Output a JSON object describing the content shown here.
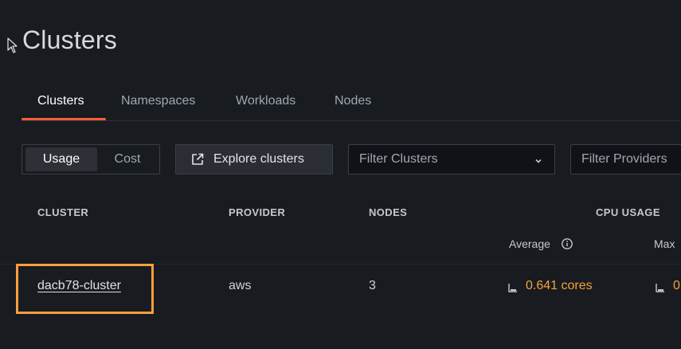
{
  "page": {
    "title": "Clusters"
  },
  "tabs": [
    {
      "label": "Clusters",
      "active": true
    },
    {
      "label": "Namespaces",
      "active": false
    },
    {
      "label": "Workloads",
      "active": false
    },
    {
      "label": "Nodes",
      "active": false
    }
  ],
  "toolbar": {
    "view_toggle": {
      "options": [
        "Usage",
        "Cost"
      ],
      "selected": "Usage"
    },
    "explore_label": "Explore clusters",
    "filter_clusters_placeholder": "Filter Clusters",
    "filter_providers_placeholder": "Filter Providers"
  },
  "table": {
    "columns": {
      "cluster": "CLUSTER",
      "provider": "PROVIDER",
      "nodes": "NODES",
      "cpu_usage": "CPU USAGE"
    },
    "cpu_subcolumns": {
      "average": "Average",
      "max": "Max"
    },
    "rows": [
      {
        "cluster": "dacb78-cluster",
        "provider": "aws",
        "nodes": "3",
        "cpu_average": "0.641 cores",
        "cpu_max": "0"
      }
    ]
  },
  "colors": {
    "accent": "#f55f3e",
    "highlight": "#ff9e3d",
    "value": "#f5a23a",
    "background": "#181b1f"
  },
  "icons": [
    "cursor-pointer-icon",
    "external-link-icon",
    "chevron-down-icon",
    "info-icon",
    "bar-chart-icon"
  ]
}
